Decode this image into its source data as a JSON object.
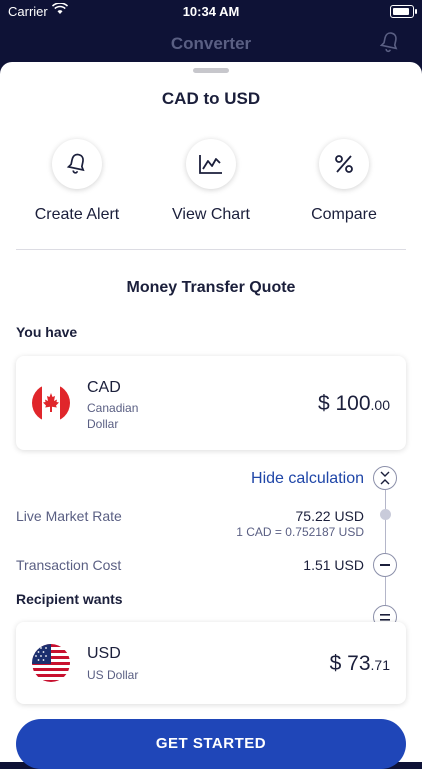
{
  "status_bar": {
    "carrier": "Carrier",
    "time": "10:34 AM"
  },
  "nav": {
    "title": "Converter"
  },
  "sheet": {
    "title": "CAD to USD",
    "actions": [
      {
        "label": "Create Alert",
        "icon": "bell-icon"
      },
      {
        "label": "View Chart",
        "icon": "chart-icon"
      },
      {
        "label": "Compare",
        "icon": "percent-icon"
      }
    ]
  },
  "quote": {
    "title": "Money Transfer Quote",
    "you_have_label": "You have",
    "from": {
      "code": "CAD",
      "name_line1": "Canadian",
      "name_line2": "Dollar",
      "amount_symbol": "$",
      "amount_int": "100",
      "amount_dec": ".00"
    },
    "hide_calc_label": "Hide calculation",
    "live_rate": {
      "label": "Live Market Rate",
      "value": "75.22 USD",
      "sub": "1 CAD = 0.752187 USD"
    },
    "transaction_cost": {
      "label": "Transaction Cost",
      "value": "1.51 USD"
    },
    "recipient_label": "Recipient wants",
    "to": {
      "code": "USD",
      "name": "US Dollar",
      "amount_symbol": "$",
      "amount_int": "73",
      "amount_dec": ".71"
    },
    "cta_label": "GET STARTED"
  },
  "colors": {
    "accent": "#1f46b8",
    "nav_bg": "#0e1236"
  }
}
